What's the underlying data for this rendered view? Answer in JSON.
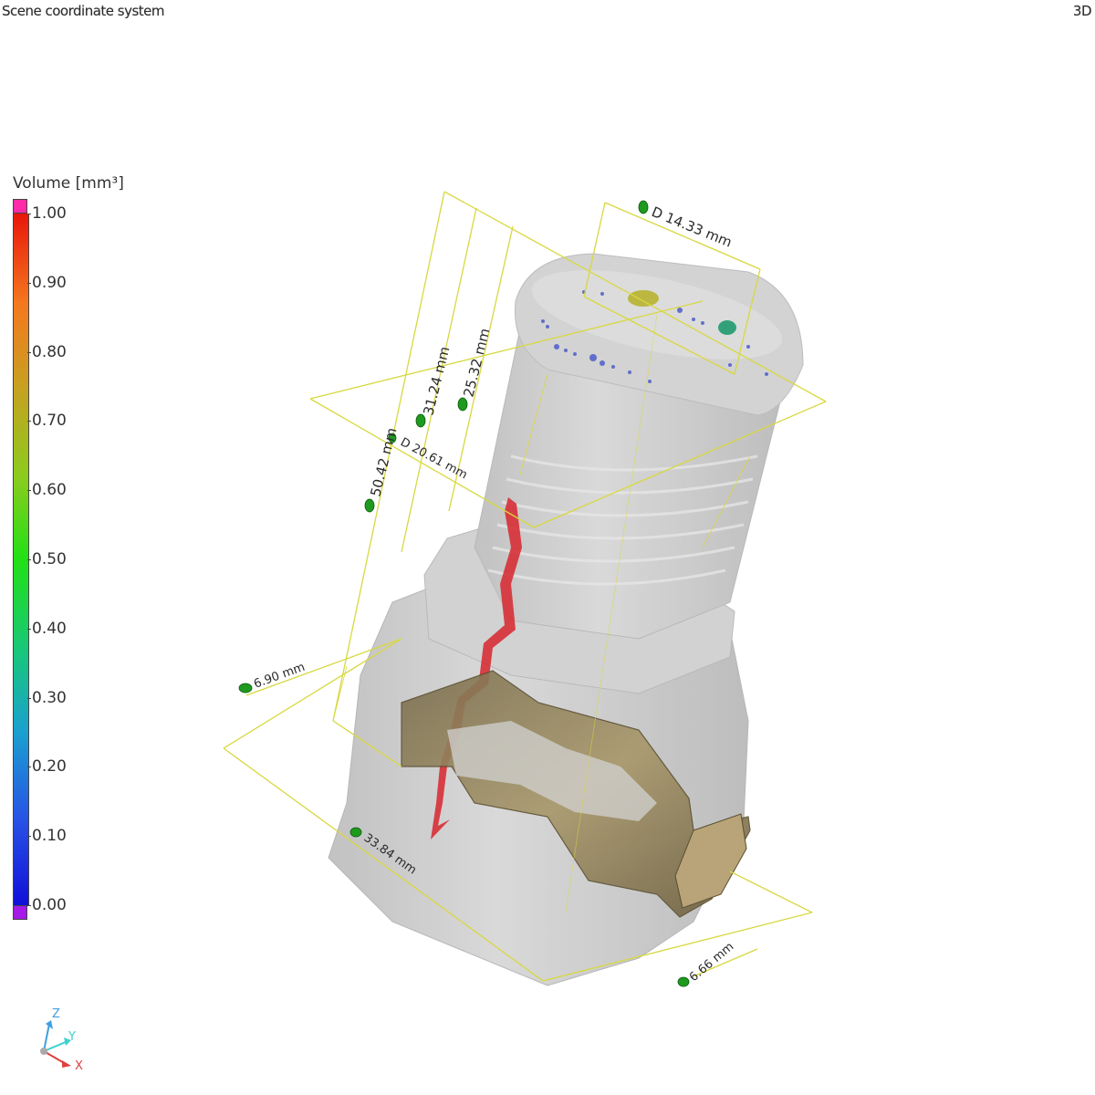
{
  "header": {
    "left_title": "Scene coordinate system",
    "right_mode": "3D"
  },
  "legend": {
    "title": "Volume [mm³]",
    "ticks": [
      "1.00",
      "0.90",
      "0.80",
      "0.70",
      "0.60",
      "0.50",
      "0.40",
      "0.30",
      "0.20",
      "0.10",
      "0.00"
    ],
    "colors": {
      "over_range": "#ff2aa8",
      "under_range": "#a41ae6",
      "scale_top": "#e8160a",
      "scale_bottom": "#1010d8"
    }
  },
  "measurements": {
    "d_top": "D 14.33 mm",
    "h_31": "31.24 mm",
    "h_25": "25.32 mm",
    "h_50": "50.42 mm",
    "d_mid": "D 20.61 mm",
    "w_690": "6.90 mm",
    "w_3384": "33.84 mm",
    "w_666": "6.66 mm"
  },
  "axis_triad": {
    "z": "Z",
    "y": "Y",
    "x": "X"
  },
  "colors": {
    "measure_line": "#d8d840",
    "measure_marker": "#1e9a1e",
    "part_gray": "#c8c8c8",
    "crack_red": "#d8262e",
    "clip_bronze": "#8f8058"
  }
}
